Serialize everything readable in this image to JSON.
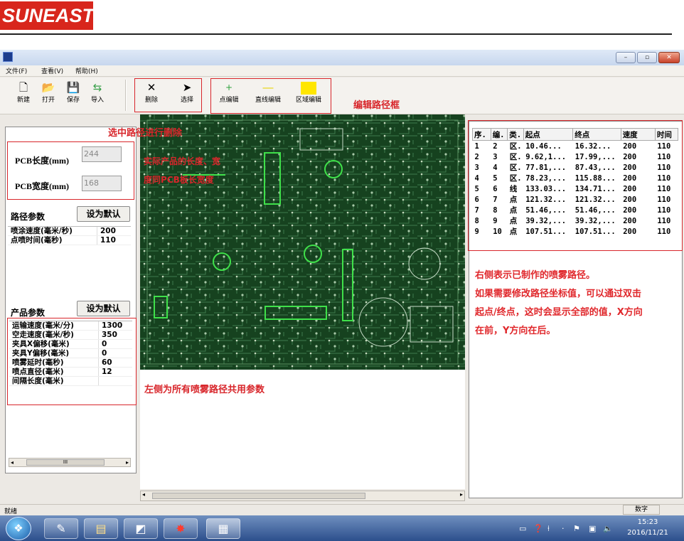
{
  "logo": {
    "text": "SUNEAST"
  },
  "window": {
    "title": ""
  },
  "menu": [
    {
      "label": "文件(F)"
    },
    {
      "label": "查看(V)"
    },
    {
      "label": "帮助(H)"
    }
  ],
  "toolbar": {
    "new": "新建",
    "open": "打开",
    "save": "保存",
    "import": "导入",
    "delete": "删除",
    "select": "选择",
    "point_edit": "点编辑",
    "line_edit": "直线编辑",
    "area_edit": "区域编辑",
    "edit_path_frame": "编辑路径框"
  },
  "left": {
    "pcb_length_label": "PCB长度(mm)",
    "pcb_length_value": "244",
    "pcb_width_label": "PCB宽度(mm)",
    "pcb_width_value": "168",
    "path_params_title": "路径参数",
    "set_default": "设为默认",
    "path_params": [
      {
        "name": "喷涂速度(毫米/秒)",
        "value": "200"
      },
      {
        "name": "点喷时间(毫秒)",
        "value": "110"
      }
    ],
    "product_params_title": "产品参数",
    "set_default2": "设为默认",
    "product_params": [
      {
        "name": "运输速度(毫米/分)",
        "value": "1300"
      },
      {
        "name": "空走速度(毫米/秒)",
        "value": "350"
      },
      {
        "name": "夹具X偏移(毫米)",
        "value": "0"
      },
      {
        "name": "夹具Y偏移(毫米)",
        "value": "0"
      },
      {
        "name": "喷雾延时(毫秒)",
        "value": "60"
      },
      {
        "name": "喷点直径(毫米)",
        "value": "12"
      },
      {
        "name": "间隔长度(毫米)",
        "value": ""
      }
    ],
    "scroll_label": "III"
  },
  "annotations": {
    "select_delete": "选中路径进行删除",
    "actual_size_1": "实际产品的长度、宽",
    "actual_size_2": "度同PCB板长宽度",
    "left_shared": "左侧为所有喷雾路径共用参数",
    "right_1": "右侧表示已制作的喷雾路径。",
    "right_2": "如果需要修改路径坐标值，可以通过双击",
    "right_3": "起点/终点，这时会显示全部的值，X方向",
    "right_4": "在前，Y方向在后。"
  },
  "table": {
    "headers": [
      "序.",
      "编.",
      "类.",
      "起点",
      "终点",
      "速度",
      "时间"
    ],
    "rows": [
      [
        "1",
        "2",
        "区.",
        "10.46...",
        "16.32...",
        "200",
        "110"
      ],
      [
        "2",
        "3",
        "区.",
        "9.62,1...",
        "17.99,...",
        "200",
        "110"
      ],
      [
        "3",
        "4",
        "区.",
        "77.81,...",
        "87.43,...",
        "200",
        "110"
      ],
      [
        "4",
        "5",
        "区.",
        "78.23,...",
        "115.88...",
        "200",
        "110"
      ],
      [
        "5",
        "6",
        "线",
        "133.03...",
        "134.71...",
        "200",
        "110"
      ],
      [
        "6",
        "7",
        "点",
        "121.32...",
        "121.32...",
        "200",
        "110"
      ],
      [
        "7",
        "8",
        "点",
        "51.46,...",
        "51.46,...",
        "200",
        "110"
      ],
      [
        "8",
        "9",
        "点",
        "39.32,...",
        "39.32,...",
        "200",
        "110"
      ],
      [
        "9",
        "10",
        "点",
        "107.51...",
        "107.51...",
        "200",
        "110"
      ]
    ]
  },
  "status": {
    "left": "就绪",
    "right": "数字"
  },
  "taskbar": {
    "time": "15:23",
    "date": "2016/11/21"
  },
  "colors": {
    "accent_red": "#d8262b",
    "logo_red": "#d8261c",
    "pcb_green": "#14381d",
    "path_green": "#3fe04a"
  }
}
